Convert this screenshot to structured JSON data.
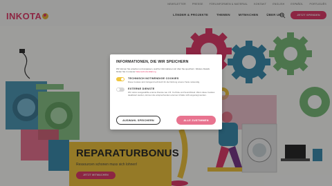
{
  "utility_nav": [
    "NEWSLETTER",
    "PRESSE",
    "FÖRLINFORMEN & MATERIAL",
    "KONTAKT",
    "ENGLISH",
    "ESPAÑOL",
    "PORTUGUÊS"
  ],
  "logo": {
    "text": "INKOTA"
  },
  "main_nav": [
    "LÄNDER & PROJEKTE",
    "THEMEN",
    "MITMACHEN",
    "ÜBER UNS"
  ],
  "donate_button": "JETZT SPENDEN",
  "hero": {
    "title": "REPARATURBONUS",
    "subtitle": "Ressourcen schonen muss sich lohnen!",
    "cta": "JETZT MITMACHEN"
  },
  "cookie": {
    "title": "INFORMATIONEN, DIE WIR SPEICHERN",
    "intro": "Wir können Sie ansehen und anpassen, welche Informationen wir über Sie speichern. Weitere Details finden Sie in unserer ",
    "intro_link": "Datenschutzerklärung",
    "options": [
      {
        "title": "TECHNISCH NOTWENDIGE COOKIES",
        "desc": "Diese Cookies sind zwingend technisch für die Nutzung unserer Seite notwendig.",
        "enabled": true
      },
      {
        "title": "EXTERNE DIENSTE",
        "desc": "Wir nutzen ausgewählte externe Dienste wie z.B. YouTube und SoundCloud. Wenn diese Cookies deaktiviert werden, können die entsprechenden externen Inhalte nicht angezeigt werden.",
        "enabled": false
      }
    ],
    "select_button": "AUSWAHL SPEICHERN",
    "accept_button": "ALLE ZUSTIMMEN"
  },
  "colors": {
    "brand": "#e33e6c",
    "yellow": "#f0c63f",
    "green": "#7dbd7c",
    "blue": "#3e8fb0"
  }
}
